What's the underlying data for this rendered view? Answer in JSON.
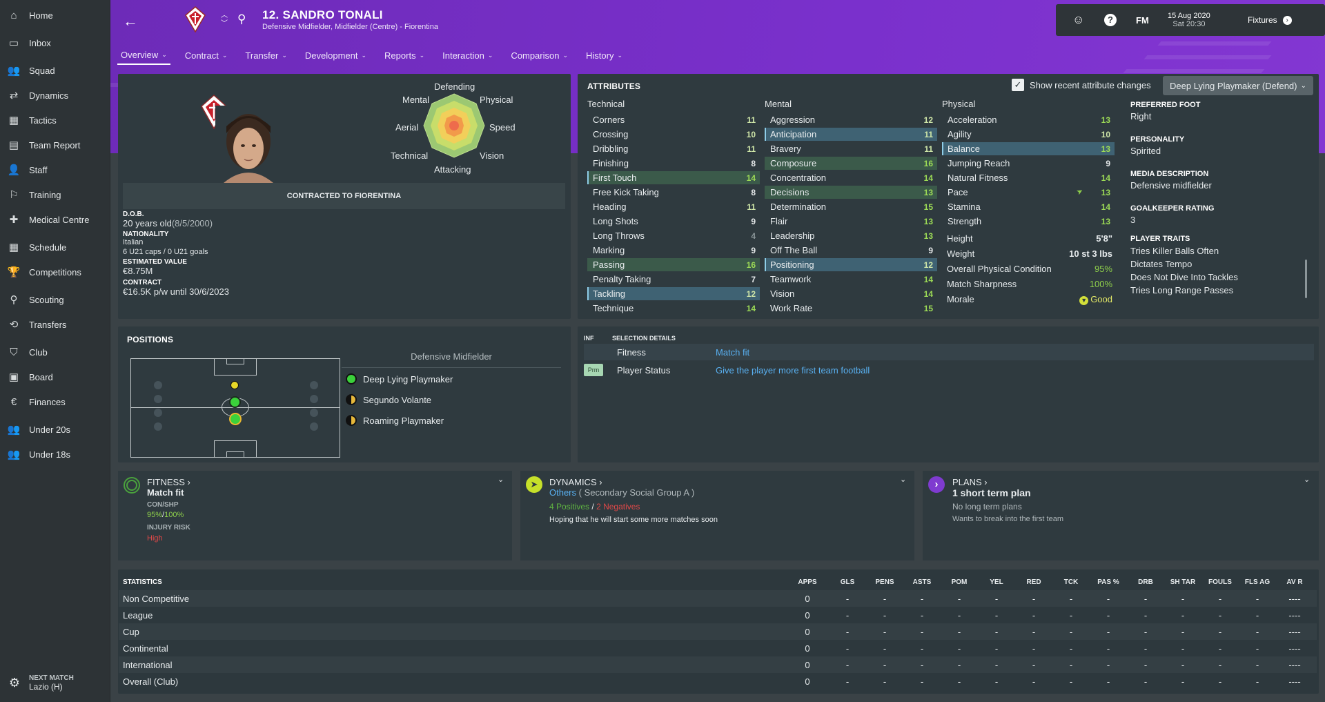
{
  "sidebar": {
    "items": [
      {
        "label": "Home",
        "icon": "home-icon",
        "glyph": "⌂"
      },
      {
        "label": "Inbox",
        "icon": "inbox-icon",
        "glyph": "▭"
      },
      {
        "label": "Squad",
        "icon": "squad-icon",
        "glyph": "👥"
      },
      {
        "label": "Dynamics",
        "icon": "dynamics-icon",
        "glyph": "⇄"
      },
      {
        "label": "Tactics",
        "icon": "tactics-icon",
        "glyph": "▦"
      },
      {
        "label": "Team Report",
        "icon": "report-icon",
        "glyph": "▤"
      },
      {
        "label": "Staff",
        "icon": "staff-icon",
        "glyph": "👤"
      },
      {
        "label": "Training",
        "icon": "training-icon",
        "glyph": "⚐"
      },
      {
        "label": "Medical Centre",
        "icon": "medical-icon",
        "glyph": "✚"
      },
      {
        "label": "Schedule",
        "icon": "schedule-icon",
        "glyph": "▦"
      },
      {
        "label": "Competitions",
        "icon": "trophy-icon",
        "glyph": "🏆"
      },
      {
        "label": "Scouting",
        "icon": "scouting-icon",
        "glyph": "⚲"
      },
      {
        "label": "Transfers",
        "icon": "transfers-icon",
        "glyph": "⟲"
      },
      {
        "label": "Club",
        "icon": "club-icon",
        "glyph": "⛉"
      },
      {
        "label": "Board",
        "icon": "board-icon",
        "glyph": "▣"
      },
      {
        "label": "Finances",
        "icon": "finances-icon",
        "glyph": "€"
      },
      {
        "label": "Under 20s",
        "icon": "u20-icon",
        "glyph": "👥"
      },
      {
        "label": "Under 18s",
        "icon": "u18-icon",
        "glyph": "👥"
      }
    ],
    "next_match": {
      "label": "NEXT MATCH",
      "value": "Lazio (H)"
    }
  },
  "header": {
    "name": "12. SANDRO TONALI",
    "subtitle": "Defensive Midfielder, Midfielder (Centre) - Fiorentina",
    "fm": "FM",
    "date": "15 Aug 2020",
    "time": "Sat 20:30",
    "fixtures": "Fixtures",
    "tabs": [
      "Overview",
      "Contract",
      "Transfer",
      "Development",
      "Reports",
      "Interaction",
      "Comparison",
      "History"
    ]
  },
  "overview": {
    "radar": {
      "defending": "Defending",
      "mental": "Mental",
      "physical": "Physical",
      "aerial": "Aerial",
      "speed": "Speed",
      "technical": "Technical",
      "vision": "Vision",
      "attacking": "Attacking"
    },
    "contracted": "CONTRACTED TO FIORENTINA",
    "dob_label": "D.O.B.",
    "dob": "20 years old",
    "dob_date": "(8/5/2000)",
    "nationality_label": "NATIONALITY",
    "nationality": "Italian",
    "caps": "6 U21 caps / 0 U21 goals",
    "value_label": "ESTIMATED VALUE",
    "value": "€8.75M",
    "contract_label": "CONTRACT",
    "contract": "€16.5K p/w until 30/6/2023"
  },
  "attributes": {
    "title": "ATTRIBUTES",
    "show_recent": "Show recent attribute changes",
    "role": "Deep Lying Playmaker (Defend)",
    "technical_head": "Technical",
    "mental_head": "Mental",
    "physical_head": "Physical",
    "technical": [
      {
        "name": "Corners",
        "value": "11"
      },
      {
        "name": "Crossing",
        "value": "10"
      },
      {
        "name": "Dribbling",
        "value": "11"
      },
      {
        "name": "Finishing",
        "value": "8"
      },
      {
        "name": "First Touch",
        "value": "14"
      },
      {
        "name": "Free Kick Taking",
        "value": "8"
      },
      {
        "name": "Heading",
        "value": "11"
      },
      {
        "name": "Long Shots",
        "value": "9"
      },
      {
        "name": "Long Throws",
        "value": "4"
      },
      {
        "name": "Marking",
        "value": "9"
      },
      {
        "name": "Passing",
        "value": "16"
      },
      {
        "name": "Penalty Taking",
        "value": "7"
      },
      {
        "name": "Tackling",
        "value": "12"
      },
      {
        "name": "Technique",
        "value": "14"
      }
    ],
    "mental": [
      {
        "name": "Aggression",
        "value": "12"
      },
      {
        "name": "Anticipation",
        "value": "11"
      },
      {
        "name": "Bravery",
        "value": "11"
      },
      {
        "name": "Composure",
        "value": "16"
      },
      {
        "name": "Concentration",
        "value": "14"
      },
      {
        "name": "Decisions",
        "value": "13"
      },
      {
        "name": "Determination",
        "value": "15"
      },
      {
        "name": "Flair",
        "value": "13"
      },
      {
        "name": "Leadership",
        "value": "13"
      },
      {
        "name": "Off The Ball",
        "value": "9"
      },
      {
        "name": "Positioning",
        "value": "12"
      },
      {
        "name": "Teamwork",
        "value": "14"
      },
      {
        "name": "Vision",
        "value": "14"
      },
      {
        "name": "Work Rate",
        "value": "15"
      }
    ],
    "physical": [
      {
        "name": "Acceleration",
        "value": "13"
      },
      {
        "name": "Agility",
        "value": "10"
      },
      {
        "name": "Balance",
        "value": "13"
      },
      {
        "name": "Jumping Reach",
        "value": "9"
      },
      {
        "name": "Natural Fitness",
        "value": "14"
      },
      {
        "name": "Pace",
        "value": "13"
      },
      {
        "name": "Stamina",
        "value": "14"
      },
      {
        "name": "Strength",
        "value": "13"
      }
    ],
    "height_label": "Height",
    "height": "5'8\"",
    "weight_label": "Weight",
    "weight": "10 st 3 lbs",
    "condition_label": "Overall Physical Condition",
    "condition": "95%",
    "sharpness_label": "Match Sharpness",
    "sharpness": "100%",
    "morale_label": "Morale",
    "morale": "Good",
    "foot_label": "PREFERRED FOOT",
    "foot": "Right",
    "personality_label": "PERSONALITY",
    "personality": "Spirited",
    "media_label": "MEDIA DESCRIPTION",
    "media": "Defensive midfielder",
    "gk_label": "GOALKEEPER RATING",
    "gk": "3",
    "traits_label": "PLAYER TRAITS",
    "traits": [
      "Tries Killer Balls Often",
      "Dictates Tempo",
      "Does Not Dive Into Tackles",
      "Tries Long Range Passes"
    ]
  },
  "positions": {
    "title": "POSITIONS",
    "current": "Defensive Midfielder",
    "roles": [
      {
        "name": "Deep Lying Playmaker",
        "type": "full"
      },
      {
        "name": "Segundo Volante",
        "type": "half"
      },
      {
        "name": "Roaming Playmaker",
        "type": "half"
      }
    ]
  },
  "selection": {
    "inf": "INF",
    "title": "SELECTION DETAILS",
    "rows": [
      {
        "tag": "",
        "label": "Fitness",
        "value": "Match fit"
      },
      {
        "tag": "Prm",
        "label": "Player Status",
        "value": "Give the player more first team football"
      }
    ]
  },
  "fitness_card": {
    "title": "FITNESS ›",
    "status": "Match fit",
    "conshp_label": "CON/SHP",
    "con": "95%",
    "sep": "/",
    "shp": "100%",
    "injury_label": "INJURY RISK",
    "injury": "High"
  },
  "dynamics_card": {
    "title": "DYNAMICS ›",
    "group": "Others",
    "group_sub": "( Secondary Social Group A )",
    "positives": "4 Positives",
    "sep": "/",
    "negatives": "2 Negatives",
    "note": "Hoping that he will start some more matches soon"
  },
  "plans_card": {
    "title": "PLANS ›",
    "main": "1 short term plan",
    "sub1": "No long term plans",
    "sub2": "Wants to break into the first team"
  },
  "statistics": {
    "title": "STATISTICS",
    "columns": [
      "APPS",
      "GLS",
      "PENS",
      "ASTS",
      "POM",
      "YEL",
      "RED",
      "TCK",
      "PAS %",
      "DRB",
      "SH TAR",
      "FOULS",
      "FLS AG",
      "AV R"
    ],
    "rows": [
      {
        "name": "Non Competitive",
        "apps": "0",
        "dash": "-",
        "avr": "----"
      },
      {
        "name": "League",
        "apps": "0",
        "dash": "-",
        "avr": "----"
      },
      {
        "name": "Cup",
        "apps": "0",
        "dash": "-",
        "avr": "----"
      },
      {
        "name": "Continental",
        "apps": "0",
        "dash": "-",
        "avr": "----"
      },
      {
        "name": "International",
        "apps": "0",
        "dash": "-",
        "avr": "----"
      },
      {
        "name": "Overall (Club)",
        "apps": "0",
        "dash": "-",
        "avr": "----"
      }
    ]
  },
  "colors": {
    "accent": "#7a30cc",
    "panel": "#2f3a3f",
    "green": "#8fd04b",
    "blue_link": "#59b1f2",
    "red": "#e04848"
  }
}
